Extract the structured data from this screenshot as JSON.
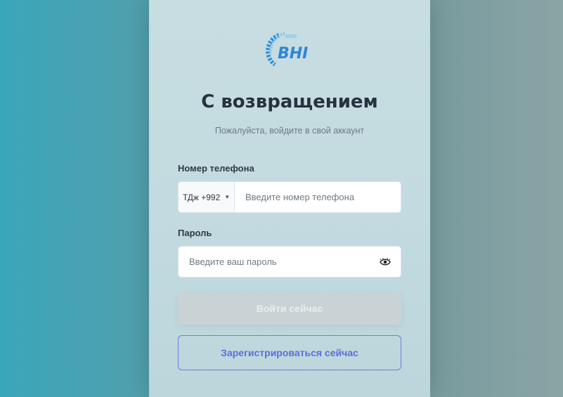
{
  "brand": {
    "logo_text": "BHI",
    "logo_color": "#2f8fd8"
  },
  "header": {
    "title": "С возвращением",
    "subtitle": "Пожалуйста, войдите в свой аккаунт"
  },
  "phone": {
    "label": "Номер телефона",
    "country_code": "ТДж +992",
    "placeholder": "Введите номер телефона",
    "value": ""
  },
  "password": {
    "label": "Пароль",
    "placeholder": "Введите ваш пароль",
    "value": "",
    "toggle_icon": "eye-icon"
  },
  "actions": {
    "login_label": "Войти сейчас",
    "register_label": "Зарегистрироваться сейчас",
    "accent_color": "#5b6fdc"
  }
}
